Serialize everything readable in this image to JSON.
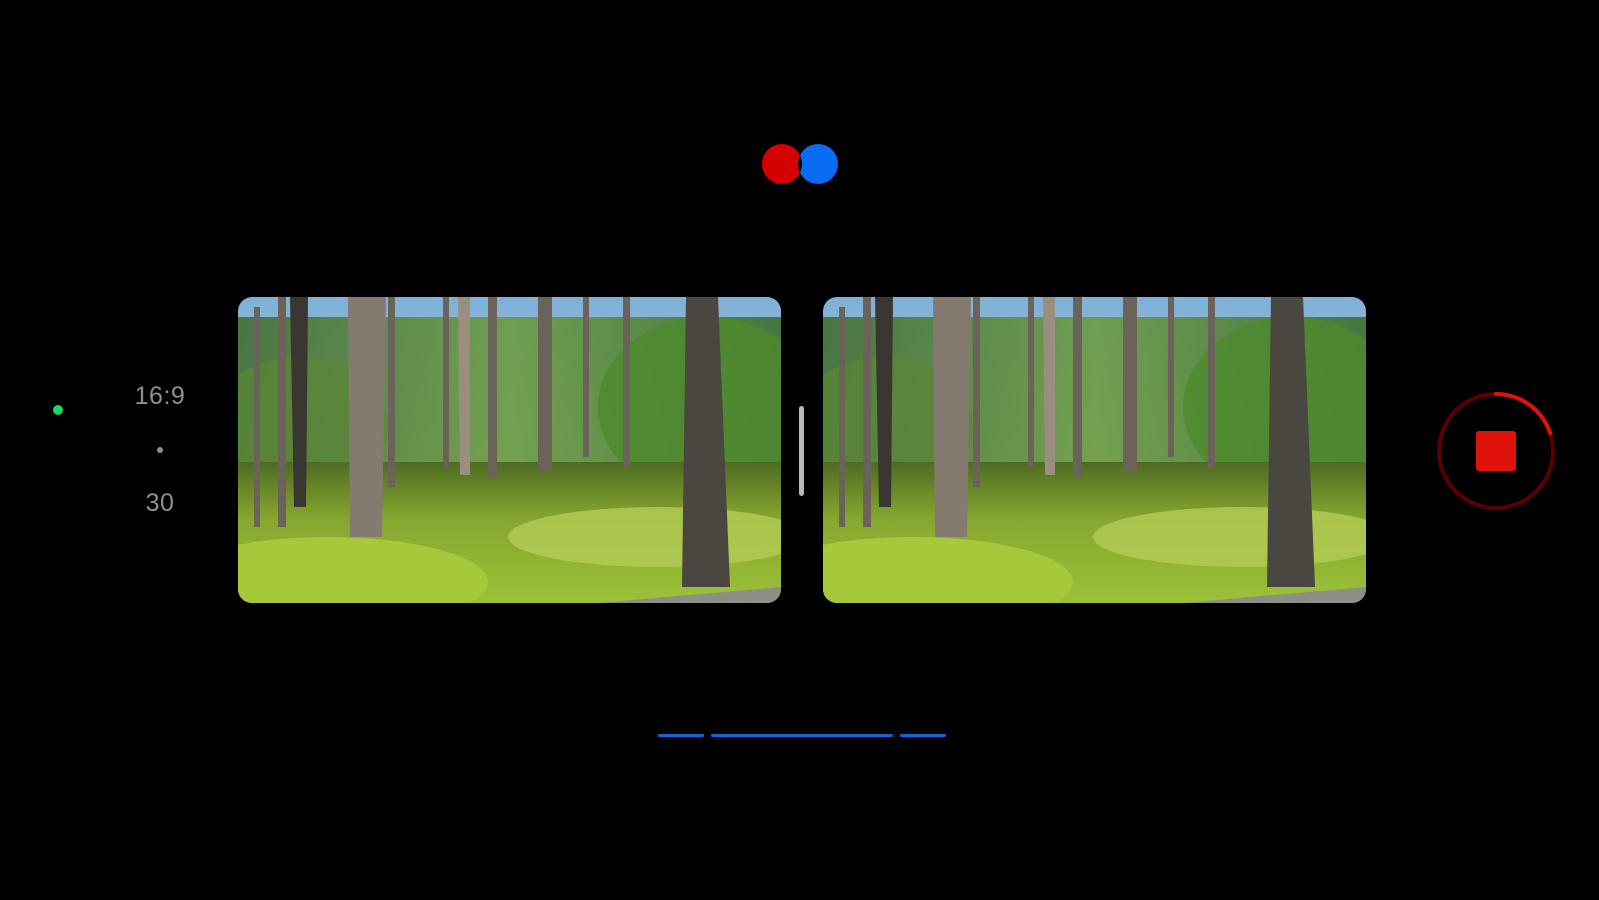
{
  "mode_icon": {
    "name": "anaglyph-mode-icon",
    "left_color": "#d50000",
    "right_color": "#0a6cf2"
  },
  "status": {
    "indicator_color": "#1ed760",
    "format": "16:9",
    "fps": "30"
  },
  "record": {
    "icon": "stop-icon",
    "ring_color": "#5a0000",
    "progress_color": "#e0120c",
    "stop_color": "#e0120c",
    "progress": 0.2
  },
  "level_bar": {
    "color": "#1565d8"
  }
}
